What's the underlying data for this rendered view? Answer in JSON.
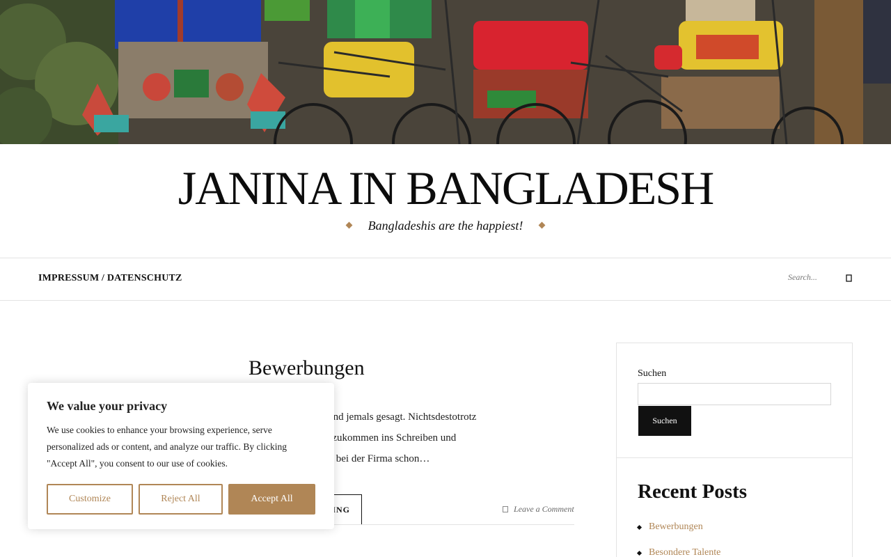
{
  "header": {
    "site_title": "JANINA IN BANGLADESH",
    "tagline": "Bangladeshis are the happiest!"
  },
  "nav": {
    "items": [
      {
        "label": "IMPRESSUM / DATENSCHUTZ"
      }
    ],
    "search_placeholder": "Search..."
  },
  "post": {
    "title": "Bewerbungen",
    "excerpt_lines": [
      "cht Spaß. Hat niemand jemals gesagt. Nichtsdestotrotz",
      "fach um wieder reinzukommen ins Schreiben und",
      "äre genau dieser Job bei der Firma schon…"
    ],
    "continue_label": "ING",
    "comment_link": "Leave a Comment"
  },
  "sidebar": {
    "search_label": "Suchen",
    "search_button": "Suchen",
    "recent_title": "Recent Posts",
    "recent_posts": [
      {
        "label": "Bewerbungen"
      },
      {
        "label": "Besondere Talente"
      }
    ]
  },
  "cookie": {
    "title": "We value your privacy",
    "text": "We use cookies to enhance your browsing experience, serve personalized ads or content, and analyze our traffic. By clicking \"Accept All\", you consent to our use of cookies.",
    "customize": "Customize",
    "reject": "Reject All",
    "accept": "Accept All"
  },
  "colors": {
    "accent": "#b08656",
    "text": "#111111",
    "border": "#e3e3e3"
  },
  "icons": {
    "search": "search-icon",
    "comment": "comment-icon",
    "diamond": "diamond-icon"
  }
}
